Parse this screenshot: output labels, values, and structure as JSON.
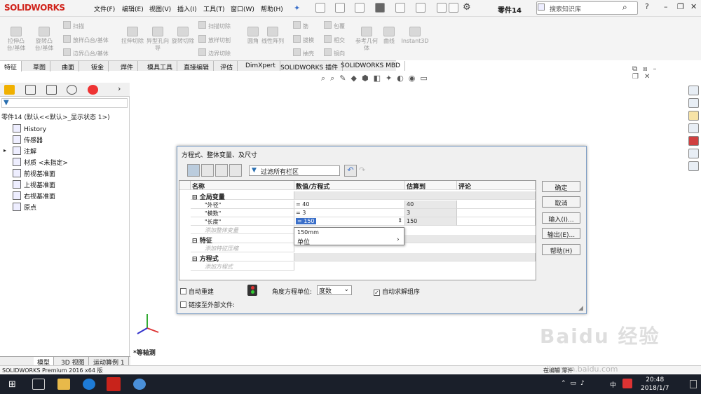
{
  "app": {
    "logo": "SOLIDWORKS",
    "doc_title": "零件14",
    "search_placeholder": "搜索知识库"
  },
  "menu": [
    "文件(F)",
    "编辑(E)",
    "视图(V)",
    "插入(I)",
    "工具(T)",
    "窗口(W)",
    "帮助(H)"
  ],
  "ribbon": {
    "big": [
      "拉伸凸台/基体",
      "旋转凸台/基体",
      "拉伸切除",
      "异型孔向导",
      "旋转切除",
      "圆角",
      "线性阵列",
      "参考几何体",
      "曲线",
      "Instant3D"
    ],
    "small": [
      "扫描",
      "放样凸台/基体",
      "边界凸台/基体",
      "扫描切除",
      "放样切割",
      "边界切除",
      "筋",
      "拔模",
      "抽壳",
      "包覆",
      "相交",
      "镜向"
    ]
  },
  "tabs": [
    "特征",
    "草图",
    "曲面",
    "钣金",
    "焊件",
    "模具工具",
    "直接编辑",
    "评估",
    "DimXpert",
    "SOLIDWORKS 插件",
    "SOLIDWORKS MBD"
  ],
  "tree": [
    "零件14 (默认<<默认>_显示状态 1>)",
    "History",
    "传感器",
    "注解",
    "材质 <未指定>",
    "前视基准面",
    "上视基准面",
    "右视基准面",
    "原点"
  ],
  "dialog": {
    "title": "方程式、整体变量、及尺寸",
    "filter": "过滤所有栏区",
    "headers": [
      "名称",
      "数值/方程式",
      "估算到",
      "评论"
    ],
    "group_global": "全局变量",
    "rows": [
      {
        "name": "\"外径\"",
        "value": "= 40",
        "eval": "40"
      },
      {
        "name": "\"模数\"",
        "value": "= 3",
        "eval": "3"
      },
      {
        "name": "\"长度\"",
        "value": "= 150",
        "eval": "150"
      }
    ],
    "add_global": "添加整体变量",
    "group_feature": "特征",
    "add_feature": "添加特征压缩",
    "group_equation": "方程式",
    "add_equation": "添加方程式",
    "popup_value": "150mm",
    "popup_unit": "单位",
    "auto_rebuild": "自动重建",
    "angle_label": "角度方程单位:",
    "angle_value": "度数",
    "auto_solve": "自动求解组序",
    "link_external": "链接至外部文件:",
    "buttons": [
      "确定",
      "取消",
      "输入(I)...",
      "输出(E)...",
      "帮助(H)"
    ]
  },
  "view_label": "*等轴测",
  "bottom_tabs": [
    "模型",
    "3D 视图",
    "运动算例 1"
  ],
  "status": "SOLIDWORKS Premium 2016 x64 版",
  "status_right": "在编辑 零件",
  "taskbar": {
    "time": "20:48",
    "date": "2018/1/7",
    "ime": "中"
  },
  "watermark": {
    "brand": "Baidu 经验",
    "url": "jingyan.baidu.com"
  },
  "colors": {
    "accent": "#d0231b",
    "selection": "#3a6fc9",
    "taskbar": "#1a1f2a"
  }
}
